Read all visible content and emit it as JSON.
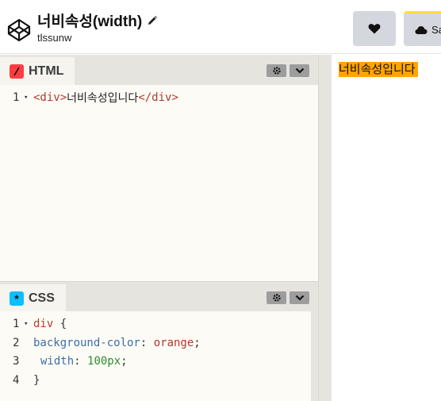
{
  "header": {
    "title": "너비속성(width)",
    "author": "tlssunw",
    "save_label": "Sa"
  },
  "html_pane": {
    "tab_label": "HTML",
    "badge_color": "#ff3c41",
    "lines": [
      {
        "num": "1",
        "open_tag": "<div>",
        "text": "너비속성입니다",
        "close_tag": "</div>"
      }
    ]
  },
  "css_pane": {
    "tab_label": "CSS",
    "badge_color": "#0ebeff",
    "line_numbers": [
      "1",
      "2",
      "3",
      "4"
    ],
    "selector": "div",
    "open_brace": " {",
    "prop1": "background-color",
    "val1": "orange",
    "prop2": "width",
    "val2": "100px",
    "close_brace": "}",
    "colon": ": ",
    "semicolon": ";"
  },
  "preview": {
    "text": "너비속성입니다",
    "bg_color": "orange"
  },
  "colors": {
    "accent_save_border": "#ffdd40",
    "editor_bg": "#fcfbf5",
    "chrome_bg": "#e6e4de"
  }
}
